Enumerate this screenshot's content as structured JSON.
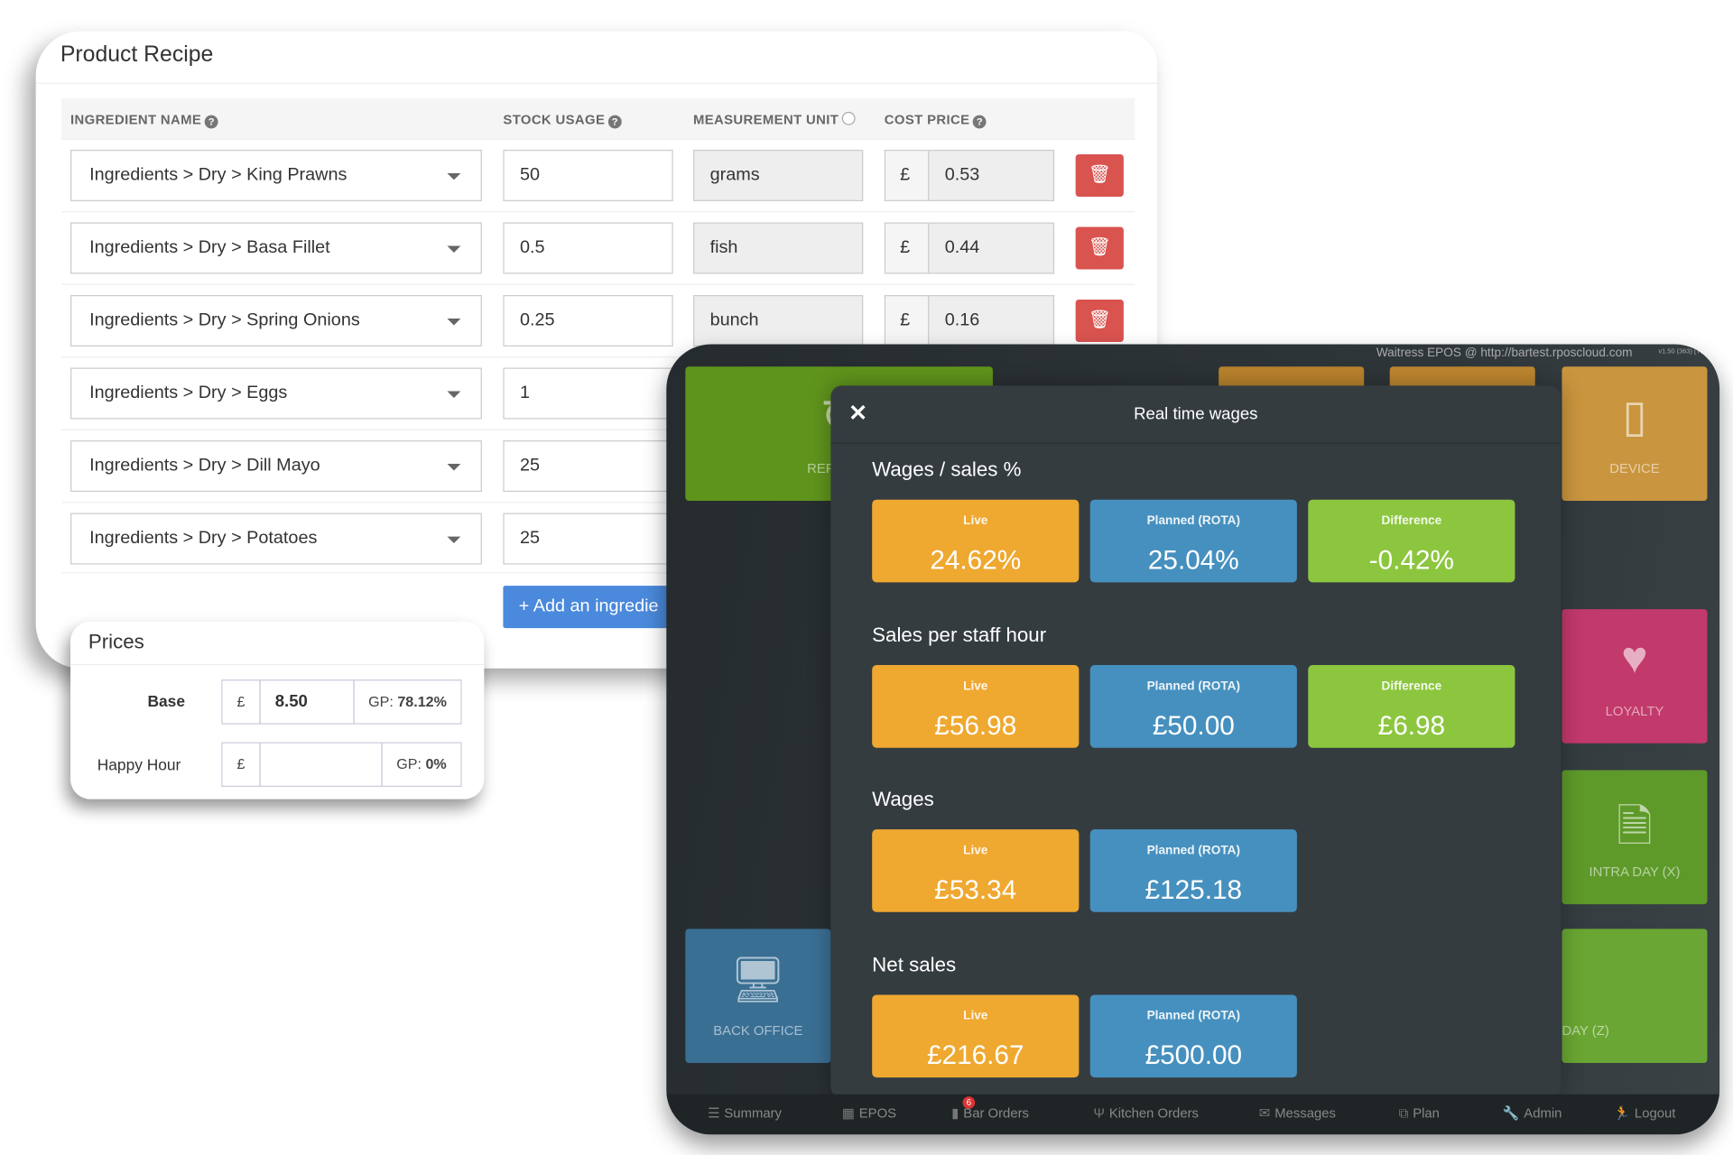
{
  "recipe": {
    "title": "Product Recipe",
    "headers": {
      "ingredient": "INGREDIENT NAME",
      "stock": "STOCK USAGE",
      "unit": "MEASUREMENT UNIT",
      "cost": "COST PRICE"
    },
    "currency": "£",
    "delete_icon": "trash-icon",
    "rows": [
      {
        "ingredient": "Ingredients > Dry > King Prawns",
        "stock": "50",
        "unit": "grams",
        "cost": "0.53"
      },
      {
        "ingredient": "Ingredients > Dry > Basa Fillet",
        "stock": "0.5",
        "unit": "fish",
        "cost": "0.44"
      },
      {
        "ingredient": "Ingredients > Dry > Spring Onions",
        "stock": "0.25",
        "unit": "bunch",
        "cost": "0.16"
      },
      {
        "ingredient": "Ingredients > Dry > Eggs",
        "stock": "1"
      },
      {
        "ingredient": "Ingredients > Dry > Dill Mayo",
        "stock": "25"
      },
      {
        "ingredient": "Ingredients > Dry > Potatoes",
        "stock": "25"
      }
    ],
    "add_button": "+ Add an ingredie"
  },
  "prices": {
    "title": "Prices",
    "currency": "£",
    "rows": [
      {
        "label": "Base",
        "value": "8.50",
        "gp_label": "GP:",
        "gp": "78.12%"
      },
      {
        "label": "Happy Hour",
        "value": "",
        "gp_label": "GP:",
        "gp": "0%"
      }
    ]
  },
  "tablet": {
    "header": "Waitress EPOS @ http://bartest.rposcloud.com",
    "version": "v1.50 (363) [TF]",
    "tiles": {
      "refresh": "REFRESH",
      "device": "DEVICE",
      "loyalty": "LOYALTY",
      "intraday": "INTRA DAY (X)",
      "dayz": "DAY (Z)",
      "backoffice": "BACK OFFICE"
    },
    "colors": {
      "live": "#efa830",
      "planned": "#4690bf",
      "difference": "#8cc63f"
    },
    "modal": {
      "title": "Real time wages",
      "sections": [
        {
          "title": "Wages / sales %",
          "live_label": "Live",
          "live": "24.62%",
          "planned_label": "Planned (ROTA)",
          "planned": "25.04%",
          "diff_label": "Difference",
          "diff": "-0.42%"
        },
        {
          "title": "Sales per staff hour",
          "live_label": "Live",
          "live": "£56.98",
          "planned_label": "Planned (ROTA)",
          "planned": "£50.00",
          "diff_label": "Difference",
          "diff": "£6.98"
        },
        {
          "title": "Wages",
          "live_label": "Live",
          "live": "£53.34",
          "planned_label": "Planned (ROTA)",
          "planned": "£125.18"
        },
        {
          "title": "Net sales",
          "live_label": "Live",
          "live": "£216.67",
          "planned_label": "Planned (ROTA)",
          "planned": "£500.00"
        }
      ]
    },
    "nav": [
      "Summary",
      "EPOS",
      "Bar Orders",
      "Kitchen Orders",
      "Messages",
      "Plan",
      "Admin",
      "Logout"
    ],
    "bar_orders_badge": "6"
  }
}
